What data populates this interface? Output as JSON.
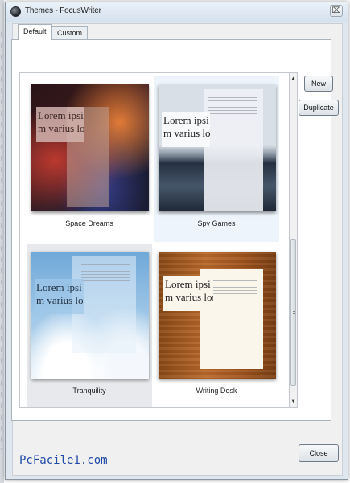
{
  "window": {
    "title": "Themes - FocusWriter"
  },
  "titlebar": {
    "close_glyph": "⌧"
  },
  "tabs": [
    {
      "label": "Default",
      "active": true
    },
    {
      "label": "Custom",
      "active": false
    }
  ],
  "themes": [
    {
      "name": "Space Dreams",
      "sample_text": "Lorem ipsi\nm varius lore"
    },
    {
      "name": "Spy Games",
      "sample_text": "Lorem ipsi\nm varius lore"
    },
    {
      "name": "Tranquility",
      "sample_text": "Lorem ipsi\nm varius lore"
    },
    {
      "name": "Writing Desk",
      "sample_text": "Lorem ipsi\nm varius lore"
    }
  ],
  "buttons": {
    "new": "New",
    "duplicate": "Duplicate",
    "close": "Close"
  },
  "scrollbar": {
    "up_glyph": "▲",
    "down_glyph": "▼"
  },
  "watermark": "PcFacile1.com",
  "colors": {
    "selection": "#eef4fc",
    "watermark": "#1f4aa8"
  }
}
